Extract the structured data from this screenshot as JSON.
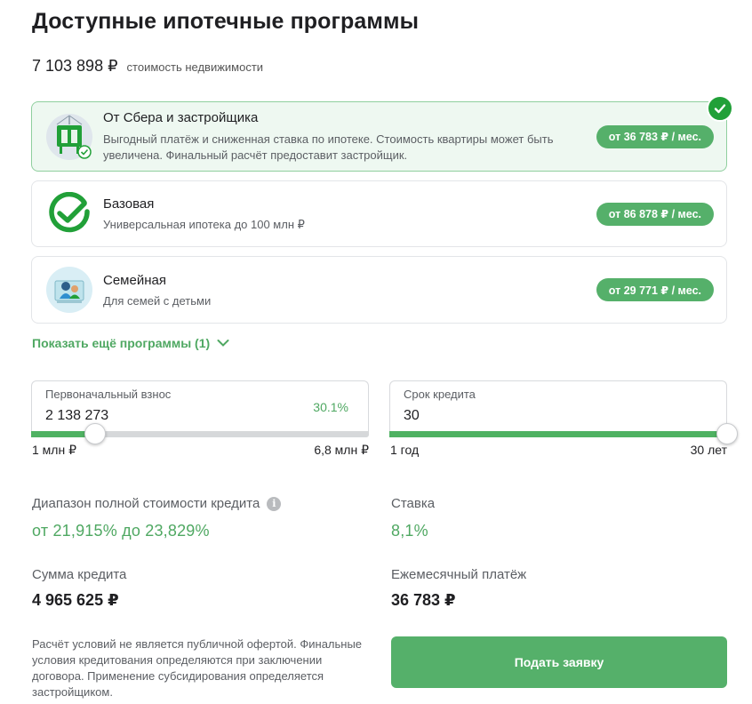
{
  "header": {
    "title": "Доступные ипотечные программы",
    "property_price": "7 103 898 ₽",
    "property_price_label": "стоимость недвижимости"
  },
  "programs": [
    {
      "title": "От Сбера и застройщика",
      "description": "Выгодный платёж и сниженная ставка по ипотеке. Стоимость квартиры может быть увеличена. Финальный расчёт предоставит застройщик.",
      "payment": "от 36 783 ₽ / мес.",
      "selected": true,
      "icon": "building-crane-icon"
    },
    {
      "title": "Базовая",
      "description": "Универсальная ипотека до 100 млн ₽",
      "payment": "от 86 878 ₽ / мес.",
      "selected": false,
      "icon": "check-circle-icon"
    },
    {
      "title": "Семейная",
      "description": "Для семей с детьми",
      "payment": "от 29 771 ₽ / мес.",
      "selected": false,
      "icon": "family-icon"
    }
  ],
  "show_more": {
    "label": "Показать ещё программы (1)",
    "icon": "chevron-down-icon"
  },
  "down_payment": {
    "label": "Первоначальный взнос",
    "value": "2 138 273",
    "percent": "30.1%",
    "min_label": "1 млн ₽",
    "max_label": "6,8 млн ₽",
    "slider_fraction": 0.19
  },
  "loan_term": {
    "label": "Срок кредита",
    "value": "30",
    "min_label": "1 год",
    "max_label": "30 лет",
    "slider_fraction": 1.0
  },
  "results": {
    "full_cost_label": "Диапазон полной стоимости кредита",
    "full_cost_value": "от 21,915% до 23,829%",
    "rate_label": "Ставка",
    "rate_value": "8,1%",
    "loan_sum_label": "Сумма кредита",
    "loan_sum_value": "4 965 625 ₽",
    "monthly_label": "Ежемесячный платёж",
    "monthly_value": "36 783 ₽"
  },
  "disclaimer": "Расчёт условий не является публичной офертой. Финальные условия кредитования определяются при заключении договора. Применение субсидирования определяется застройщиком.",
  "submit_label": "Подать заявку",
  "colors": {
    "accent": "#21a038",
    "button": "#55b06a",
    "green_text": "#4fa862",
    "selected_bg": "#eef8f1"
  }
}
